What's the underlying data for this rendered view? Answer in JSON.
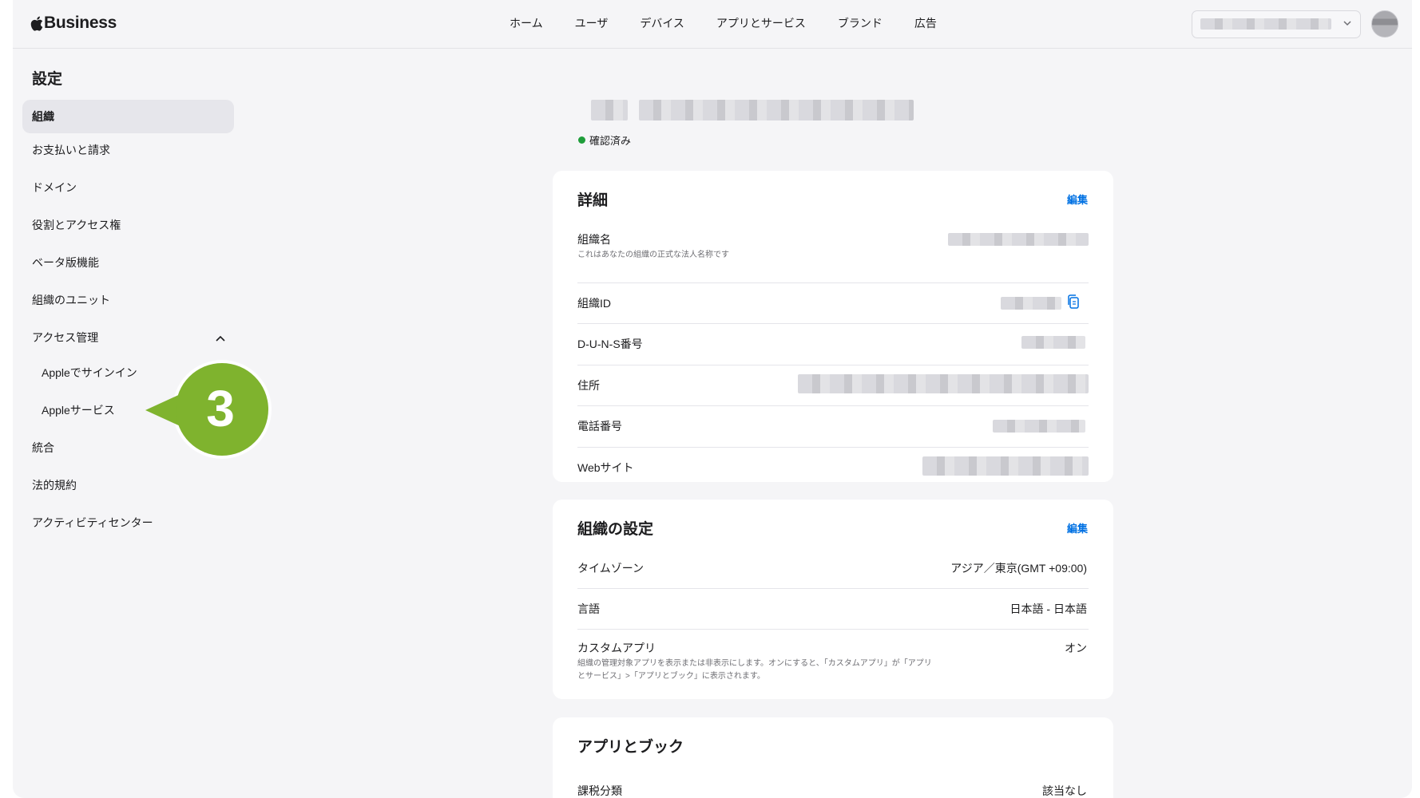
{
  "brand": {
    "name": "Business"
  },
  "nav": {
    "items": [
      "ホーム",
      "ユーザ",
      "デバイス",
      "アプリとサービス",
      "ブランド",
      "広告"
    ]
  },
  "sidebar": {
    "title": "設定",
    "items": [
      "組織",
      "お支払いと請求",
      "ドメイン",
      "役割とアクセス権",
      "ベータ版機能",
      "組織のユニット",
      "アクセス管理",
      "Appleでサインイン",
      "Appleサービス",
      "統合",
      "法的規約",
      "アクティビティセンター"
    ]
  },
  "callout": {
    "number": "3",
    "color": "#7fb32e"
  },
  "org": {
    "status": "確認済み",
    "status_color": "#1f9d3a"
  },
  "details": {
    "title": "詳細",
    "edit": "編集",
    "rows": [
      {
        "label": "組織名",
        "desc": "これはあなたの組織の正式な法人名称です"
      },
      {
        "label": "組織ID"
      },
      {
        "label": "D-U-N-S番号"
      },
      {
        "label": "住所"
      },
      {
        "label": "電話番号"
      },
      {
        "label": "Webサイト"
      }
    ]
  },
  "org_settings": {
    "title": "組織の設定",
    "edit": "編集",
    "rows": [
      {
        "label": "タイムゾーン",
        "value": "アジア／東京(GMT +09:00)"
      },
      {
        "label": "言語",
        "value": "日本語 - 日本語"
      },
      {
        "label": "カスタムアプリ",
        "value": "オン",
        "desc": "組織の管理対象アプリを表示または非表示にします。オンにすると、「カスタムアプリ」が「アプリとサービス」>「アプリとブック」に表示されます。"
      }
    ]
  },
  "apps_books": {
    "title": "アプリとブック",
    "rows": [
      {
        "label": "課税分類",
        "value": "該当なし"
      }
    ]
  },
  "colors": {
    "accent": "#0071e3",
    "background": "#f5f5f7"
  }
}
